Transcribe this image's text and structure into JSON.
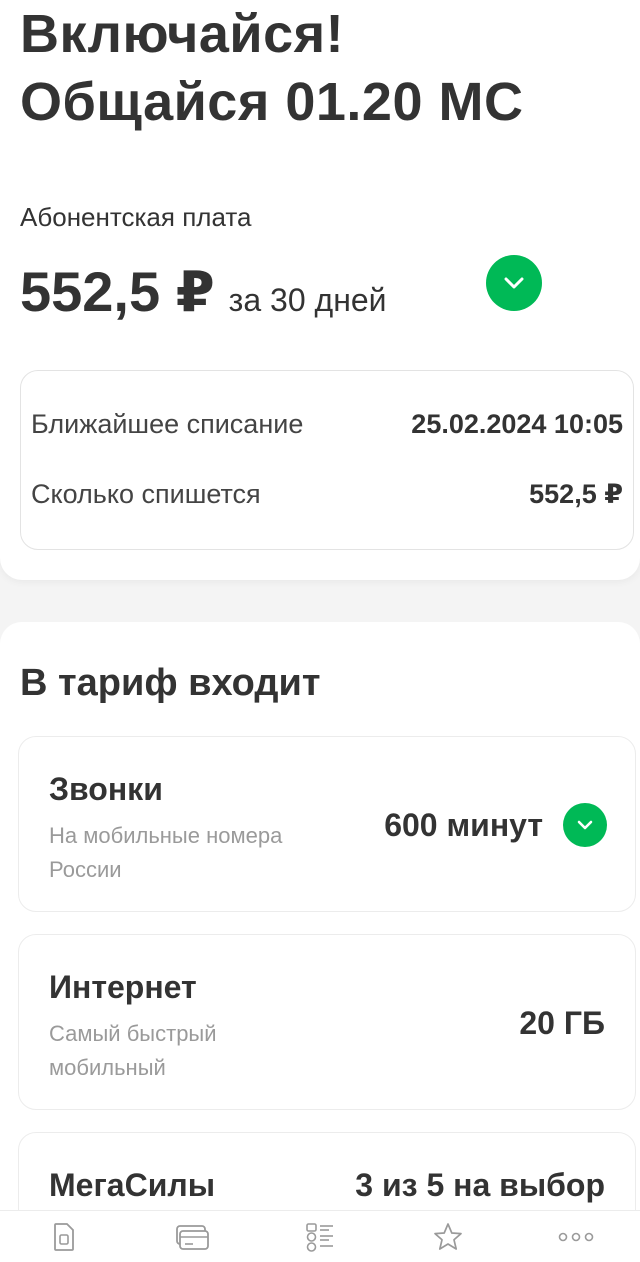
{
  "tariff": {
    "title_line1": "Включайся!",
    "title_line2": "Общайся 01.20 МС"
  },
  "subscription": {
    "label": "Абонентская плата",
    "price": "552,5 ₽",
    "period": "за 30 дней"
  },
  "charge": {
    "next_label": "Ближайшее списание",
    "next_value": "25.02.2024 10:05",
    "amount_label": "Сколько спишется",
    "amount_value": "552,5 ₽"
  },
  "includes": {
    "title": "В тариф входит",
    "items": [
      {
        "name": "Звонки",
        "description": "На мобильные номера России",
        "value": "600 минут"
      },
      {
        "name": "Интернет",
        "description": "Самый быстрый мобильный",
        "value": "20 ГБ"
      },
      {
        "name": "МегаСилы",
        "description": "",
        "value": "3 из 5 на выбор"
      }
    ]
  },
  "colors": {
    "accent": "#00b956",
    "text": "#333333",
    "muted": "#9a9a9a"
  },
  "bottom_nav": {
    "icons": [
      "sim-icon",
      "wallet-icon",
      "services-list-icon",
      "star-icon",
      "more-icon"
    ]
  }
}
